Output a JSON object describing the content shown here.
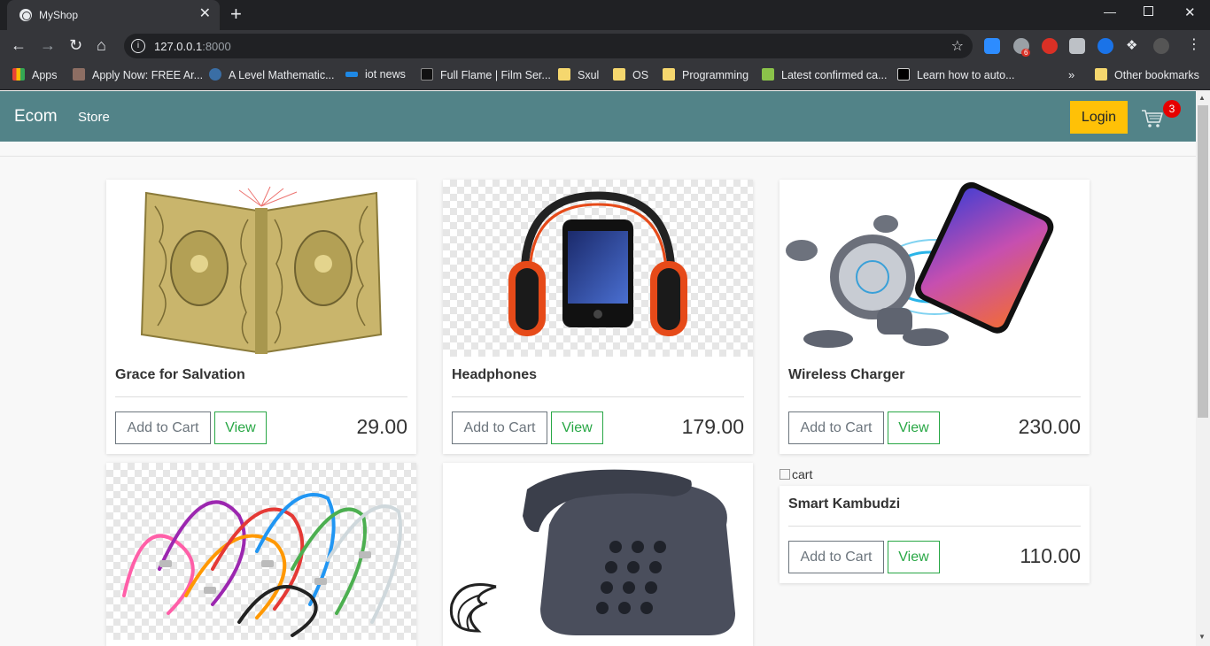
{
  "browser": {
    "tab_title": "MyShop",
    "tab_close": "✕",
    "new_tab": "+",
    "url_host": "127.0.0.1",
    "url_port": ":8000",
    "extension_badge": "6",
    "bookmarks": [
      {
        "label": "Apps"
      },
      {
        "label": "Apply Now: FREE Ar..."
      },
      {
        "label": "A Level Mathematic..."
      },
      {
        "label": "iot news"
      },
      {
        "label": "Full Flame | Film Ser..."
      },
      {
        "label": "Sxul"
      },
      {
        "label": "OS"
      },
      {
        "label": "Programming"
      },
      {
        "label": "Latest confirmed ca..."
      },
      {
        "label": "Learn how to auto..."
      }
    ],
    "bookmarks_overflow": "»",
    "other_bookmarks": "Other bookmarks"
  },
  "navbar": {
    "brand": "Ecom",
    "store_link": "Store",
    "login_label": "Login",
    "cart_count": "3"
  },
  "products": [
    {
      "name": "Grace for Salvation",
      "price": "29.00",
      "add_label": "Add to Cart",
      "view_label": "View"
    },
    {
      "name": "Headphones",
      "price": "179.00",
      "add_label": "Add to Cart",
      "view_label": "View"
    },
    {
      "name": "Wireless Charger",
      "price": "230.00",
      "add_label": "Add to Cart",
      "view_label": "View"
    },
    {
      "name": "",
      "price": ""
    },
    {
      "name": "",
      "price": ""
    },
    {
      "name": "Smart Kambudzi",
      "price": "110.00",
      "add_label": "Add to Cart",
      "view_label": "View",
      "image_alt": "cart"
    }
  ],
  "colors": {
    "navbar": "#528388",
    "login": "#ffc107",
    "cart_badge": "#e60000",
    "view_button": "#28a745"
  }
}
